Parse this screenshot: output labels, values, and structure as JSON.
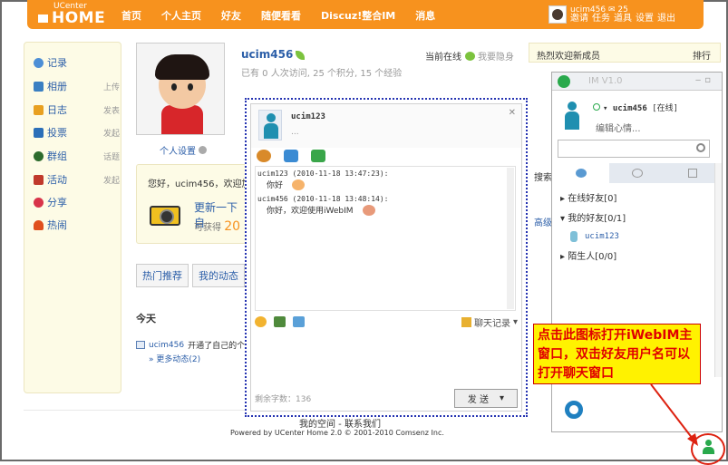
{
  "header": {
    "logo_small": "UCenter",
    "logo_big": "HOME",
    "nav": [
      "首页",
      "个人主页",
      "好友",
      "随便看看",
      "Discuz!整合IM",
      "消息"
    ],
    "user": {
      "name": "ucim456",
      "count": "25",
      "links": [
        "邀请",
        "任务",
        "道具",
        "设置",
        "退出"
      ]
    }
  },
  "sidebar": {
    "items": [
      {
        "label": "记录",
        "side": "",
        "icon": "record-icon",
        "color": "#4d8fd6"
      },
      {
        "label": "相册",
        "side": "上传",
        "icon": "album-icon",
        "color": "#3a7fc2"
      },
      {
        "label": "日志",
        "side": "发表",
        "icon": "blog-icon",
        "color": "#e8a020"
      },
      {
        "label": "投票",
        "side": "发起",
        "icon": "poll-icon",
        "color": "#2c6fb8"
      },
      {
        "label": "群组",
        "side": "话题",
        "icon": "group-icon",
        "color": "#2d6b2d"
      },
      {
        "label": "活动",
        "side": "发起",
        "icon": "event-icon",
        "color": "#c0392b"
      },
      {
        "label": "分享",
        "side": "",
        "icon": "share-icon",
        "color": "#d8344a"
      },
      {
        "label": "热闹",
        "side": "",
        "icon": "hot-icon",
        "color": "#e0501d"
      }
    ]
  },
  "profile": {
    "settings": "个人设置",
    "username": "ucim456",
    "stats": "已有 0 人次访问, 25 个积分, 15 个经验",
    "online": "当前在线",
    "hide": "我要隐身"
  },
  "welcome": {
    "text": "您好，ucim456，欢迎加入",
    "update": "更新一下自",
    "earn_label": "可获得",
    "earn_value": "20"
  },
  "tabs": [
    "热门推荐",
    "我的动态"
  ],
  "feed": {
    "today": "今天",
    "user": "ucim456",
    "text": "开通了自己的个人",
    "more": "» 更多动态(2)"
  },
  "right": {
    "title": "热烈欢迎新成员",
    "action": "排行",
    "search": "搜索",
    "advanced": "高级"
  },
  "footer": {
    "links": "我的空间 - 联系我们",
    "copyright": "Powered by UCenter Home 2.0 © 2001-2010 Comsenz Inc."
  },
  "chat": {
    "peer": "ucim123",
    "status": "...",
    "messages": [
      {
        "header": "ucim123  (2010-11-18 13:47:23):",
        "text": "你好"
      },
      {
        "header": "ucim456  (2010-11-18 13:48:14):",
        "text": "你好，欢迎使用iWebIM"
      }
    ],
    "history": "聊天记录",
    "remaining": "剩余字数：136",
    "send": "发 送"
  },
  "im": {
    "title": "IM V1.0",
    "user": "ucim456",
    "status": "[在线]",
    "mood": "编辑心情...",
    "groups": [
      "在线好友[0]",
      "我的好友[0/1]",
      "陌生人[0/0]"
    ],
    "friend": "ucim123"
  },
  "callout": {
    "text": "点击此图标打开iWebIM主窗口，双击好友用户名可以打开聊天窗口",
    "bg": "#fff200",
    "fg": "#e00000"
  }
}
